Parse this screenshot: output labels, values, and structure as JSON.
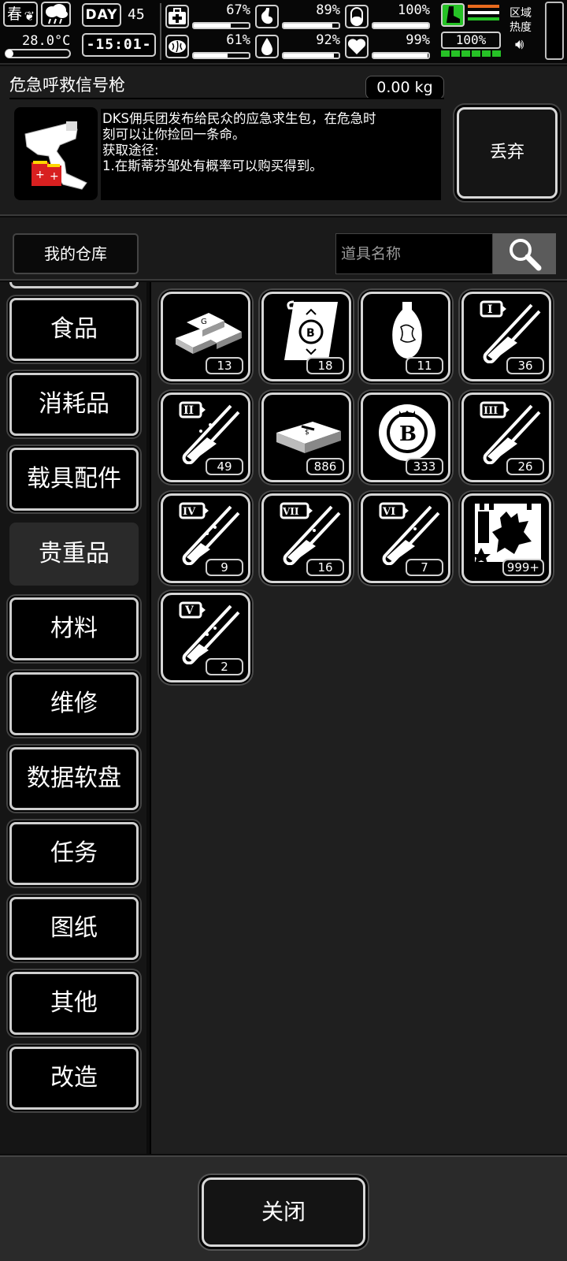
{
  "status": {
    "season": "春",
    "temperature": "28.0°C",
    "day_label": "DAY",
    "day_number": "45",
    "clock": "-15:01-",
    "stats": [
      {
        "name": "health",
        "icon": "medkit-icon",
        "value": "67%",
        "level": 0.67
      },
      {
        "name": "hunger",
        "icon": "stomach-icon",
        "value": "89%",
        "level": 0.89
      },
      {
        "name": "medicine",
        "icon": "pill-icon",
        "value": "100%",
        "level": 1.0
      },
      {
        "name": "brain",
        "icon": "brain-icon",
        "value": "61%",
        "level": 0.61
      },
      {
        "name": "thirst",
        "icon": "water-drop-icon",
        "value": "92%",
        "level": 0.92
      },
      {
        "name": "mood",
        "icon": "heart-icon",
        "value": "99%",
        "level": 0.99
      }
    ],
    "energy": "100%",
    "energy_stripe_colors": [
      "#e96a1e",
      "#ffffff",
      "#26c226"
    ],
    "region_label": "区域\n热度"
  },
  "detail": {
    "name": "危急呼救信号枪",
    "weight": "0.00 kg",
    "icon": "flare-gun-icon",
    "description": "DKS佣兵团发布给民众的应急求生包，在危急时\n刻可以让你捡回一条命。\n获取途径:\n1.在斯蒂芬邹处有概率可以购买得到。",
    "discard_label": "丢弃"
  },
  "warehouse": {
    "tab_label": "我的仓库",
    "search_placeholder": "道具名称"
  },
  "categories": [
    "食品",
    "消耗品",
    "载具配件",
    "贵重品",
    "材料",
    "维修",
    "数据软盘",
    "任务",
    "图纸",
    "其他",
    "改造"
  ],
  "active_category": "贵重品",
  "items": [
    {
      "icon": "gold-bars-icon",
      "count": "13"
    },
    {
      "icon": "bitcoin-scroll-icon",
      "count": "18"
    },
    {
      "icon": "vase-icon",
      "count": "11"
    },
    {
      "icon": "test-tube-I-icon",
      "tag": "I",
      "count": "36"
    },
    {
      "icon": "test-tube-II-icon",
      "tag": "II",
      "count": "49"
    },
    {
      "icon": "cash-stack-icon",
      "count": "886"
    },
    {
      "icon": "bitcoin-chip-icon",
      "count": "333"
    },
    {
      "icon": "test-tube-III-icon",
      "tag": "III",
      "count": "26"
    },
    {
      "icon": "test-tube-IV-icon",
      "tag": "IV",
      "count": "9"
    },
    {
      "icon": "test-tube-VII-icon",
      "tag": "VII",
      "count": "16"
    },
    {
      "icon": "test-tube-VI-icon",
      "tag": "VI",
      "count": "7"
    },
    {
      "icon": "zombie-card-icon",
      "count": "999+"
    },
    {
      "icon": "test-tube-V-icon",
      "tag": "V",
      "count": "2"
    }
  ],
  "close_label": "关闭"
}
